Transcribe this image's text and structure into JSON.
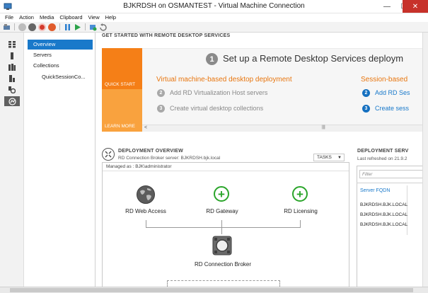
{
  "window": {
    "title": "BJKRDSH on OSMANTEST - Virtual Machine Connection",
    "minimize_glyph": "—",
    "maximize_glyph": "☐",
    "close_glyph": "✕"
  },
  "menu": [
    "File",
    "Action",
    "Media",
    "Clipboard",
    "View",
    "Help"
  ],
  "toolbar_icons": [
    "ctrl-alt-del-icon",
    "start-icon",
    "turn-off-icon",
    "shutdown-icon",
    "save-icon",
    "pause-icon",
    "resume-icon",
    "checkpoint-icon",
    "revert-icon"
  ],
  "rail_icons": [
    "dashboard-icon",
    "local-server-icon",
    "all-servers-icon",
    "file-storage-icon",
    "remote-desktop-icon"
  ],
  "nav": {
    "items": [
      "Overview",
      "Servers",
      "Collections",
      "QuickSessionCo..."
    ]
  },
  "getting_started": {
    "section_title": "GET STARTED WITH REMOTE DESKTOP SERVICES",
    "quick_start": "QUICK START",
    "learn_more": "LEARN MORE",
    "step1_num": "1",
    "step1_title": "Set up a Remote Desktop Services deploym",
    "vm_heading": "Virtual machine-based desktop deployment",
    "session_heading": "Session-based",
    "vm_steps": [
      {
        "num": "2",
        "text": "Add RD Virtualization Host servers"
      },
      {
        "num": "3",
        "text": "Create virtual desktop collections"
      }
    ],
    "session_steps": [
      {
        "num": "2",
        "text": "Add RD Ses"
      },
      {
        "num": "3",
        "text": "Create sess"
      }
    ],
    "scroll_left": "<",
    "scroll_right": ">",
    "scroll_thumb": "|||"
  },
  "deployment_overview": {
    "title": "DEPLOYMENT OVERVIEW",
    "broker_server": "RD Connection Broker server: BJKRDSH.bjk.local",
    "tasks_label": "TASKS",
    "managed_as": "Managed as : BJK\\administrator",
    "roles": {
      "web_access": "RD Web Access",
      "gateway": "RD Gateway",
      "licensing": "RD Licensing",
      "broker": "RD Connection Broker"
    },
    "plus_glyph": "+"
  },
  "deployment_servers": {
    "title": "DEPLOYMENT SERV",
    "refreshed": "Last refreshed on 21.9.2",
    "filter_placeholder": "Filter",
    "column_header": "Server FQDN",
    "rows": [
      "BJKRDSH.BJK.LOCAL",
      "BJKRDSH.BJK.LOCAL",
      "BJKRDSH.BJK.LOCAL"
    ]
  },
  "colors": {
    "accent_blue": "#1979ca",
    "orange": "#f57f17",
    "light_orange": "#f9a23e",
    "green": "#2aa52a",
    "close_red": "#c7312a"
  }
}
